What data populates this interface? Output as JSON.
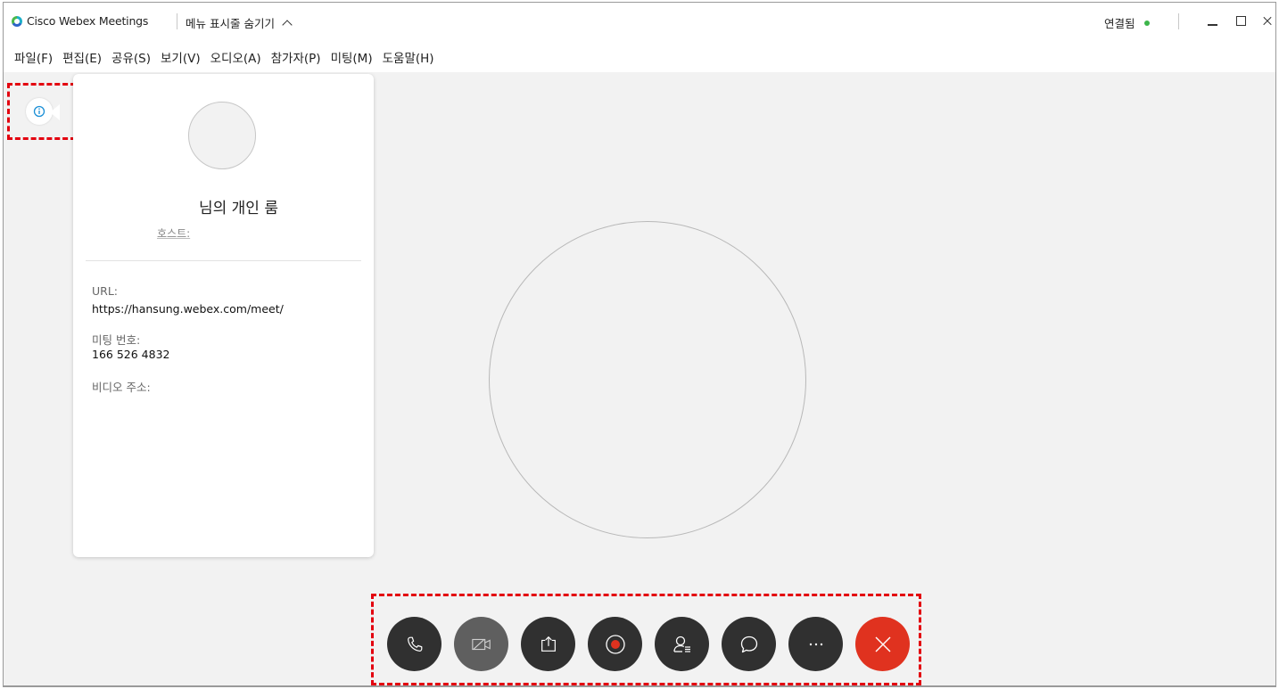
{
  "titlebar": {
    "app_title": "Cisco Webex Meetings",
    "menu_toggle_label": "메뉴 표시줄 숨기기",
    "connection_status": "연결됨",
    "status_color": "#3cb54a"
  },
  "menubar": {
    "items": [
      {
        "label": "파일(F)"
      },
      {
        "label": "편집(E)"
      },
      {
        "label": "공유(S)"
      },
      {
        "label": "보기(V)"
      },
      {
        "label": "오디오(A)"
      },
      {
        "label": "참가자(P)"
      },
      {
        "label": "미팅(M)"
      },
      {
        "label": "도움말(H)"
      }
    ]
  },
  "info_panel": {
    "room_name": "님의 개인 룸",
    "host_label": "호스트:",
    "url_label": "URL:",
    "url_value": "https://hansung.webex.com/meet/",
    "meeting_number_label": "미팅 번호:",
    "meeting_number_value": "166 526 4832",
    "video_address_label": "비디오 주소:"
  },
  "controls": [
    {
      "name": "audio-button",
      "icon": "phone-icon"
    },
    {
      "name": "video-button",
      "icon": "video-off-icon"
    },
    {
      "name": "share-button",
      "icon": "share-icon"
    },
    {
      "name": "record-button",
      "icon": "record-icon"
    },
    {
      "name": "participants-button",
      "icon": "participants-icon"
    },
    {
      "name": "chat-button",
      "icon": "chat-icon"
    },
    {
      "name": "more-button",
      "icon": "more-icon"
    },
    {
      "name": "leave-button",
      "icon": "close-icon"
    }
  ],
  "colors": {
    "end_button": "#e0321f",
    "highlight_dash": "#e3000f",
    "record_dot": "#e0321f"
  }
}
